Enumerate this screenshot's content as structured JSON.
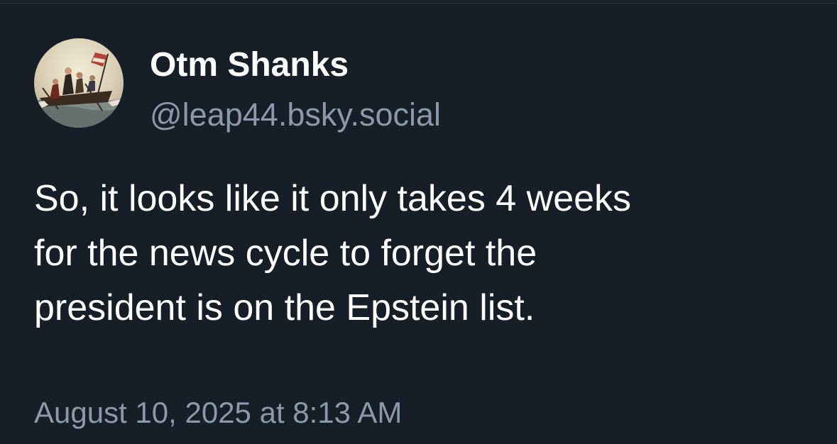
{
  "post": {
    "author": {
      "display_name": "Otm Shanks",
      "handle": "@leap44.bsky.social",
      "avatar_icon": "painting-avatar-icon"
    },
    "text_lines": [
      "So, it looks like it only takes 4 weeks",
      "for the news cycle to forget the",
      "president is on the Epstein list."
    ],
    "timestamp": "August 10, 2025 at 8:13 AM"
  },
  "colors": {
    "background": "#161e27",
    "primary_text": "#ffffff",
    "secondary_text": "#8b99aa"
  }
}
